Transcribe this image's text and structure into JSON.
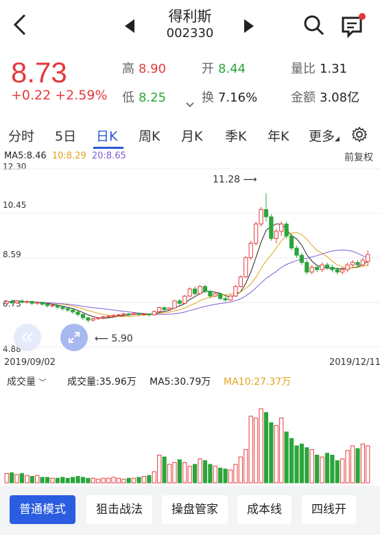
{
  "header": {
    "name": "得利斯",
    "code": "002330"
  },
  "quote": {
    "price": "8.73",
    "change": "+0.22 +2.59%",
    "high_label": "高",
    "high": "8.90",
    "low_label": "低",
    "low": "8.25",
    "open_label": "开",
    "open": "8.44",
    "turnover_label": "换",
    "turnover": "7.16%",
    "vol_ratio_label": "量比",
    "vol_ratio": "1.31",
    "amount_label": "金额",
    "amount": "3.08亿"
  },
  "tabs": [
    "分时",
    "5日",
    "日K",
    "周K",
    "月K",
    "季K",
    "年K",
    "更多"
  ],
  "active_tab": "日K",
  "ma_line": {
    "ma5": "MA5:8.46",
    "ma10": "10:8.29",
    "ma20": "20:8.65"
  },
  "adjust_label": "前复权",
  "y_ticks": [
    "12.30",
    "10.45",
    "8.59",
    "6.73",
    "4.88"
  ],
  "annotations": {
    "max": "11.28",
    "min": "5.90"
  },
  "dates": {
    "start": "2019/09/02",
    "end": "2019/12/11"
  },
  "volume": {
    "selector": "成交量",
    "total": "成交量:35.96万",
    "ma5": "MA5:30.79万",
    "ma10": "MA10:27.37万"
  },
  "bottom_buttons": [
    "普通模式",
    "狙击战法",
    "操盘管家",
    "成本线",
    "四线开"
  ],
  "colors": {
    "up": "#e4393c",
    "down": "#2aa63a",
    "accent": "#2a57d8",
    "ma5": "#222222",
    "ma10": "#e0a21a",
    "ma20": "#7e5bd6"
  },
  "chart_data": {
    "type": "candlestick",
    "ylim": [
      4.88,
      12.3
    ],
    "candles": [
      [
        6.7,
        6.78,
        6.6,
        6.82
      ],
      [
        6.78,
        6.72,
        6.65,
        6.85
      ],
      [
        6.72,
        6.8,
        6.68,
        6.84
      ],
      [
        6.8,
        6.74,
        6.7,
        6.86
      ],
      [
        6.74,
        6.78,
        6.68,
        6.82
      ],
      [
        6.78,
        6.7,
        6.62,
        6.8
      ],
      [
        6.7,
        6.74,
        6.64,
        6.78
      ],
      [
        6.74,
        6.66,
        6.6,
        6.76
      ],
      [
        6.66,
        6.6,
        6.52,
        6.7
      ],
      [
        6.6,
        6.62,
        6.54,
        6.68
      ],
      [
        6.62,
        6.54,
        6.46,
        6.64
      ],
      [
        6.54,
        6.48,
        6.4,
        6.58
      ],
      [
        6.48,
        6.42,
        6.34,
        6.52
      ],
      [
        6.42,
        6.34,
        6.26,
        6.46
      ],
      [
        6.34,
        6.24,
        6.16,
        6.38
      ],
      [
        6.24,
        6.1,
        6.0,
        6.28
      ],
      [
        6.1,
        6.0,
        5.9,
        6.14
      ],
      [
        6.0,
        6.06,
        5.94,
        6.1
      ],
      [
        6.06,
        6.1,
        6.0,
        6.14
      ],
      [
        6.1,
        6.14,
        6.04,
        6.18
      ],
      [
        6.14,
        6.16,
        6.08,
        6.2
      ],
      [
        6.16,
        6.2,
        6.1,
        6.24
      ],
      [
        6.2,
        6.22,
        6.14,
        6.26
      ],
      [
        6.22,
        6.26,
        6.16,
        6.3
      ],
      [
        6.26,
        6.24,
        6.18,
        6.3
      ],
      [
        6.24,
        6.28,
        6.2,
        6.32
      ],
      [
        6.28,
        6.24,
        6.18,
        6.3
      ],
      [
        6.24,
        6.26,
        6.18,
        6.3
      ],
      [
        6.26,
        6.22,
        6.16,
        6.28
      ],
      [
        6.22,
        6.36,
        6.18,
        6.4
      ],
      [
        6.36,
        6.52,
        6.3,
        6.56
      ],
      [
        6.52,
        6.44,
        6.38,
        6.56
      ],
      [
        6.44,
        6.5,
        6.4,
        6.54
      ],
      [
        6.5,
        6.8,
        6.46,
        6.84
      ],
      [
        6.8,
        6.7,
        6.62,
        6.88
      ],
      [
        6.7,
        7.0,
        6.66,
        7.04
      ],
      [
        7.0,
        7.3,
        6.96,
        7.36
      ],
      [
        7.3,
        7.1,
        7.04,
        7.4
      ],
      [
        7.1,
        7.4,
        7.06,
        7.46
      ],
      [
        7.4,
        7.2,
        7.12,
        7.48
      ],
      [
        7.2,
        7.0,
        6.92,
        7.26
      ],
      [
        7.0,
        7.1,
        6.96,
        7.16
      ],
      [
        7.1,
        6.9,
        6.84,
        7.14
      ],
      [
        6.9,
        6.84,
        6.76,
        6.96
      ],
      [
        6.84,
        7.0,
        6.8,
        7.06
      ],
      [
        7.0,
        7.4,
        6.96,
        7.46
      ],
      [
        7.4,
        7.8,
        7.36,
        7.86
      ],
      [
        7.8,
        8.6,
        7.76,
        8.66
      ],
      [
        8.6,
        9.2,
        8.5,
        9.3
      ],
      [
        9.2,
        10.0,
        9.1,
        10.1
      ],
      [
        10.0,
        10.6,
        9.9,
        10.7
      ],
      [
        10.6,
        10.3,
        10.1,
        11.28
      ],
      [
        10.3,
        9.4,
        9.3,
        10.4
      ],
      [
        9.4,
        9.7,
        9.2,
        9.8
      ],
      [
        9.7,
        10.0,
        9.5,
        10.1
      ],
      [
        10.0,
        9.5,
        9.4,
        10.1
      ],
      [
        9.5,
        9.0,
        8.9,
        9.6
      ],
      [
        9.0,
        8.7,
        8.6,
        9.1
      ],
      [
        8.7,
        8.4,
        8.3,
        8.8
      ],
      [
        8.4,
        8.0,
        7.9,
        8.5
      ],
      [
        8.0,
        8.2,
        7.9,
        8.3
      ],
      [
        8.2,
        8.1,
        8.0,
        8.3
      ],
      [
        8.1,
        8.3,
        8.0,
        8.4
      ],
      [
        8.3,
        8.2,
        8.1,
        8.4
      ],
      [
        8.2,
        8.1,
        8.0,
        8.3
      ],
      [
        8.1,
        8.0,
        7.9,
        8.2
      ],
      [
        8.0,
        8.1,
        7.9,
        8.2
      ],
      [
        8.1,
        8.3,
        8.0,
        8.4
      ],
      [
        8.3,
        8.4,
        8.2,
        8.5
      ],
      [
        8.4,
        8.3,
        8.2,
        8.5
      ],
      [
        8.3,
        8.5,
        8.25,
        8.6
      ],
      [
        8.44,
        8.73,
        8.25,
        8.9
      ]
    ],
    "volumes": [
      10,
      11,
      9,
      10,
      8,
      7,
      8,
      6,
      6,
      5,
      5,
      6,
      5,
      6,
      7,
      6,
      5,
      5,
      4,
      5,
      5,
      6,
      5,
      4,
      5,
      5,
      6,
      7,
      8,
      12,
      30,
      28,
      20,
      22,
      25,
      22,
      18,
      20,
      26,
      24,
      20,
      18,
      16,
      15,
      14,
      20,
      28,
      36,
      72,
      70,
      80,
      76,
      65,
      62,
      70,
      55,
      48,
      40,
      42,
      38,
      36,
      30,
      28,
      32,
      30,
      24,
      26,
      35,
      40,
      37,
      42,
      40
    ]
  }
}
